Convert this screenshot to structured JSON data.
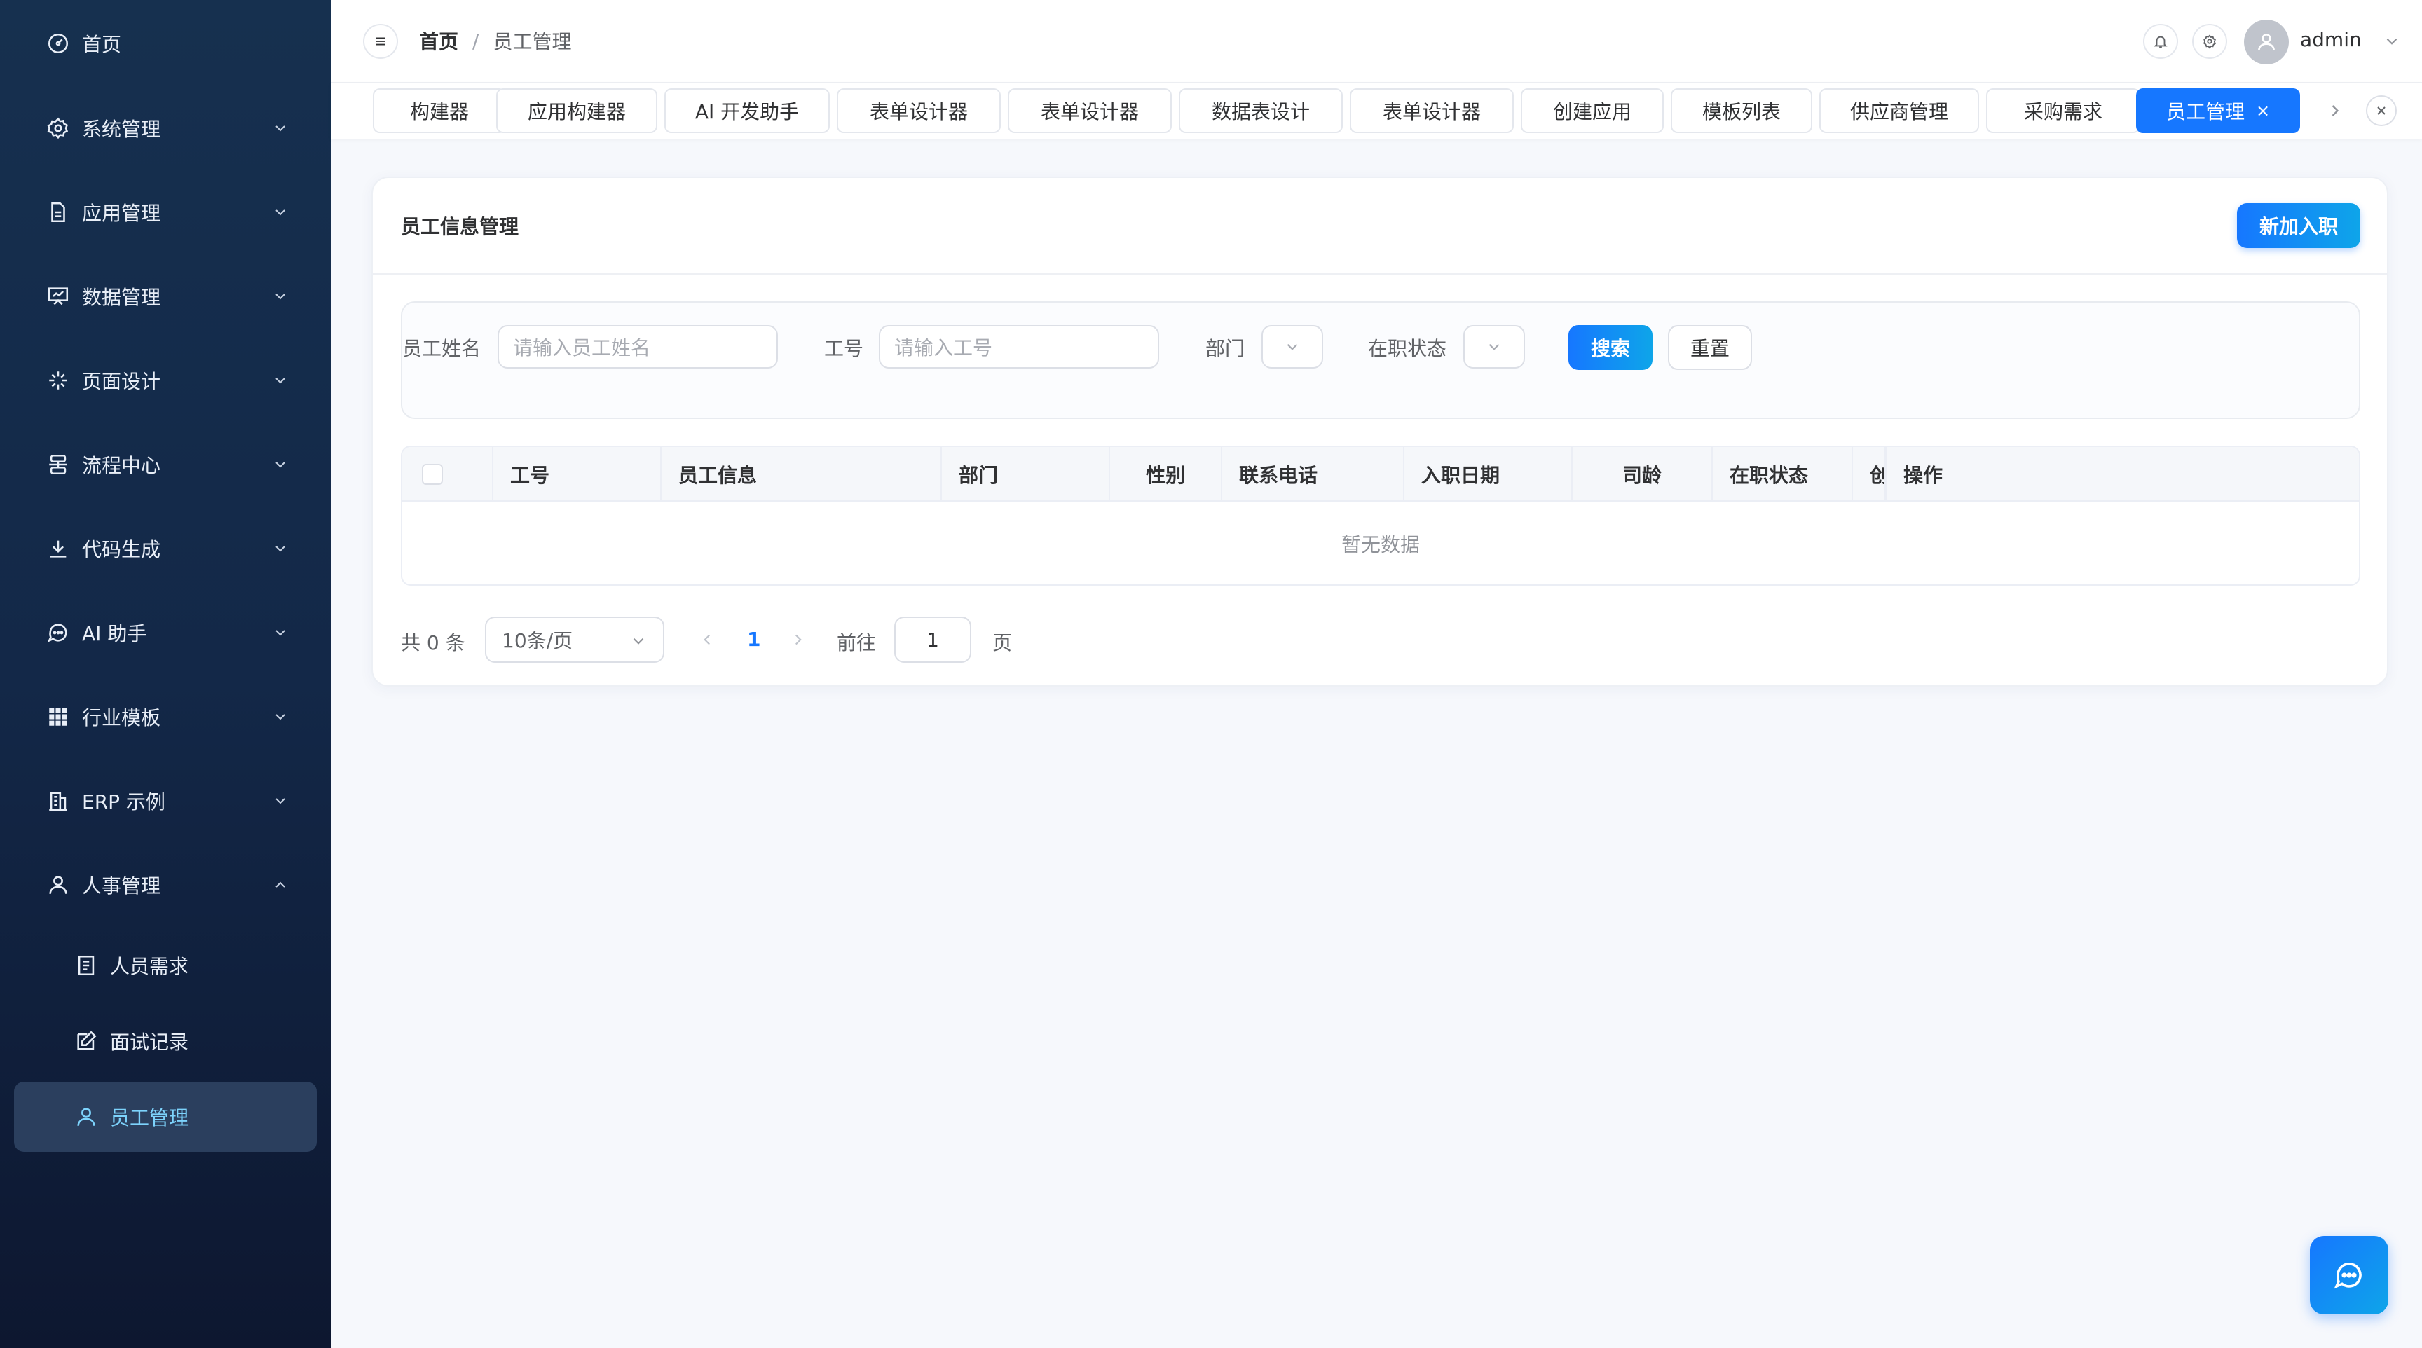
{
  "sidebar": {
    "items": [
      {
        "label": "首页",
        "icon": "dashboard-icon"
      },
      {
        "label": "系统管理",
        "icon": "gear-icon"
      },
      {
        "label": "应用管理",
        "icon": "document-icon"
      },
      {
        "label": "数据管理",
        "icon": "chart-board-icon"
      },
      {
        "label": "页面设计",
        "icon": "sparkle-icon"
      },
      {
        "label": "流程中心",
        "icon": "flow-icon"
      },
      {
        "label": "代码生成",
        "icon": "download-icon"
      },
      {
        "label": "AI 助手",
        "icon": "chat-icon"
      },
      {
        "label": "行业模板",
        "icon": "grid-icon"
      },
      {
        "label": "ERP 示例",
        "icon": "building-icon"
      },
      {
        "label": "人事管理",
        "icon": "user-icon"
      }
    ],
    "sub_items": [
      {
        "label": "人员需求",
        "icon": "list-doc-icon"
      },
      {
        "label": "面试记录",
        "icon": "edit-icon"
      },
      {
        "label": "员工管理",
        "icon": "user-icon"
      }
    ]
  },
  "header": {
    "breadcrumb_home": "首页",
    "breadcrumb_sep": "/",
    "breadcrumb_current": "员工管理",
    "username": "admin"
  },
  "tabs": [
    {
      "label": "构建器"
    },
    {
      "label": "应用构建器"
    },
    {
      "label": "AI 开发助手"
    },
    {
      "label": "表单设计器"
    },
    {
      "label": "表单设计器"
    },
    {
      "label": "数据表设计"
    },
    {
      "label": "表单设计器"
    },
    {
      "label": "创建应用"
    },
    {
      "label": "模板列表"
    },
    {
      "label": "供应商管理"
    },
    {
      "label": "采购需求"
    },
    {
      "label": "员工管理",
      "active": true
    }
  ],
  "tab_close_glyph": "×",
  "card": {
    "title": "员工信息管理",
    "new_button": "新加入职"
  },
  "filters": {
    "name_label": "员工姓名",
    "name_placeholder": "请输入员工姓名",
    "id_label": "工号",
    "id_placeholder": "请输入工号",
    "dept_label": "部门",
    "status_label": "在职状态",
    "search_button": "搜索",
    "reset_button": "重置"
  },
  "table": {
    "columns": [
      "工号",
      "员工信息",
      "部门",
      "性别",
      "联系电话",
      "入职日期",
      "司龄",
      "在职状态",
      "创",
      "操作"
    ],
    "empty_text": "暂无数据"
  },
  "pagination": {
    "total": "共 0 条",
    "page_size": "10条/页",
    "current_page": "1",
    "goto_label": "前往",
    "goto_value": "1",
    "page_label": "页"
  },
  "colors": {
    "sidebar_bg": "#16304f",
    "primary": "#1677ff",
    "active_sub_text": "#7dd3fc"
  }
}
